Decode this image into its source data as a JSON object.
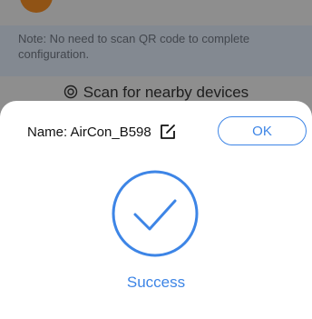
{
  "background": {
    "note": "Note: No need to scan QR code to complete configuration.",
    "scan_label": "Scan for nearby devices"
  },
  "dialog": {
    "name_label": "Name: AirCon_B598",
    "ok_label": "OK",
    "status_text": "Success"
  },
  "colors": {
    "accent": "#3d85e6",
    "note_bg": "#dbe4f2"
  },
  "icons": {
    "edit": "edit-icon",
    "success": "checkmark-circle-icon",
    "scan": "scan-icon"
  }
}
